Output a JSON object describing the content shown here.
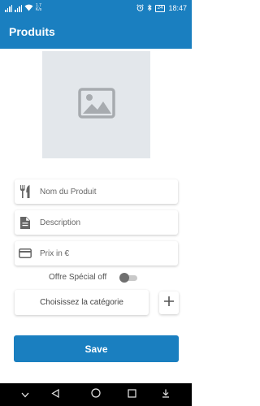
{
  "status_bar": {
    "network_top": "1.7",
    "network_bottom": "K/s",
    "battery": "24",
    "time": "18:47"
  },
  "app_bar": {
    "title": "Produits"
  },
  "form": {
    "name_placeholder": "Nom du Produit",
    "description_placeholder": "Description",
    "price_placeholder": "Prix in €",
    "special_offer_label": "Offre Spécial off",
    "special_offer_on": false,
    "category_label": "Choisissez la catégorie",
    "add_category_icon": "plus-icon",
    "save_label": "Save"
  },
  "icons": {
    "image_placeholder": "image-icon",
    "name": "fork-knife-icon",
    "description": "document-icon",
    "price": "credit-card-icon"
  },
  "colors": {
    "primary": "#1a7fc0",
    "image_placeholder_bg": "#e3e7eb",
    "nav_bar": "#000000"
  }
}
